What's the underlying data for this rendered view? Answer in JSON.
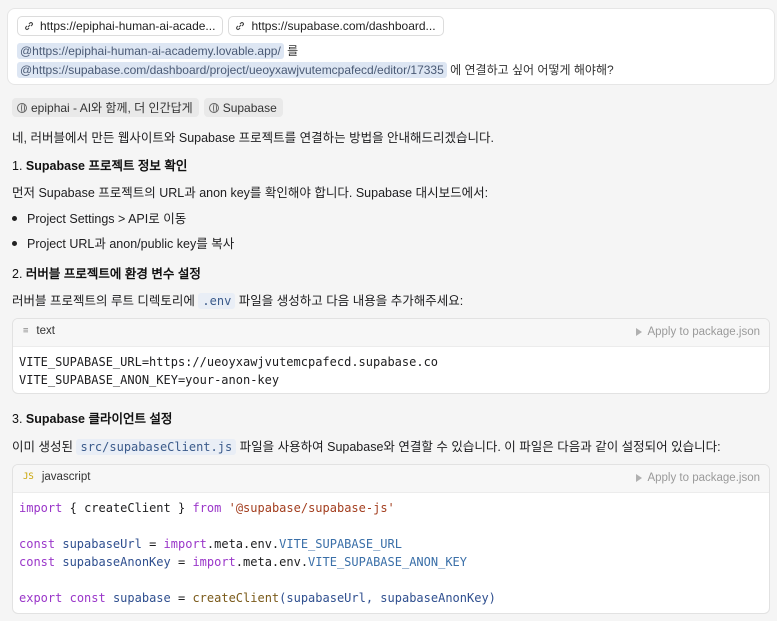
{
  "user_message": {
    "chips": [
      {
        "icon": "link-icon",
        "label": "https://epiphai-human-ai-acade..."
      },
      {
        "icon": "link-icon",
        "label": "https://supabase.com/dashboard..."
      }
    ],
    "line1_mention": "@https://epiphai-human-ai-academy.lovable.app/",
    "line1_suffix": "를",
    "line2_mention": "@https://supabase.com/dashboard/project/ueoyxawjvutemcpafecd/editor/17335",
    "line2_suffix": "에 연결하고 싶어 어떻게 해야해?"
  },
  "answer": {
    "sources": [
      {
        "icon": "globe-icon",
        "label": "epiphai - AI와 함께, 더 인간답게"
      },
      {
        "icon": "globe-icon",
        "label": "Supabase"
      }
    ],
    "intro": "네, 러버블에서 만든 웹사이트와 Supabase 프로젝트를 연결하는 방법을 안내해드리겠습니다.",
    "step1_num": "1.",
    "step1_title": "Supabase 프로젝트 정보 확인",
    "step1_text": "먼저 Supabase 프로젝트의 URL과 anon key를 확인해야 합니다. Supabase 대시보드에서:",
    "bullets": [
      "Project Settings > API로 이동",
      "Project URL과 anon/public key를 복사"
    ],
    "step2_num": "2.",
    "step2_title": "러버블 프로젝트에 환경 변수 설정",
    "step2_pre": "러버블 프로젝트의 루트 디렉토리에",
    "step2_code": ".env",
    "step2_post": "파일을 생성하고 다음 내용을 추가해주세요:",
    "code1": {
      "lang": "text",
      "apply": "Apply to package.json",
      "line1": "VITE_SUPABASE_URL=https://ueoyxawjvutemcpafecd.supabase.co",
      "line2": "VITE_SUPABASE_ANON_KEY=your-anon-key"
    },
    "step3_num": "3.",
    "step3_title": "Supabase 클라이언트 설정",
    "step3_pre": "이미 생성된",
    "step3_code": "src/supabaseClient.js",
    "step3_post": "파일을 사용하여 Supabase와 연결할 수 있습니다. 이 파일은 다음과 같이 설정되어 있습니다:",
    "code2": {
      "lang": "javascript",
      "lang_icon": "JS",
      "apply": "Apply to package.json",
      "l1_import": "import",
      "l1_brace_open": "{",
      "l1_name": "createClient",
      "l1_brace_close": "}",
      "l1_from": "from",
      "l1_module": "'@supabase/supabase-js'",
      "l3_const": "const",
      "l3_name": "supabaseUrl",
      "l3_eq": "=",
      "l3_import": "import",
      "l3_meta": ".meta.env.",
      "l3_key": "VITE_SUPABASE_URL",
      "l4_const": "const",
      "l4_name": "supabaseAnonKey",
      "l4_eq": "=",
      "l4_import": "import",
      "l4_meta": ".meta.env.",
      "l4_key": "VITE_SUPABASE_ANON_KEY",
      "l6_export": "export",
      "l6_const": "const",
      "l6_name": "supabase",
      "l6_eq": "=",
      "l6_fn": "createClient",
      "l6_args": "(supabaseUrl, supabaseAnonKey)"
    }
  }
}
